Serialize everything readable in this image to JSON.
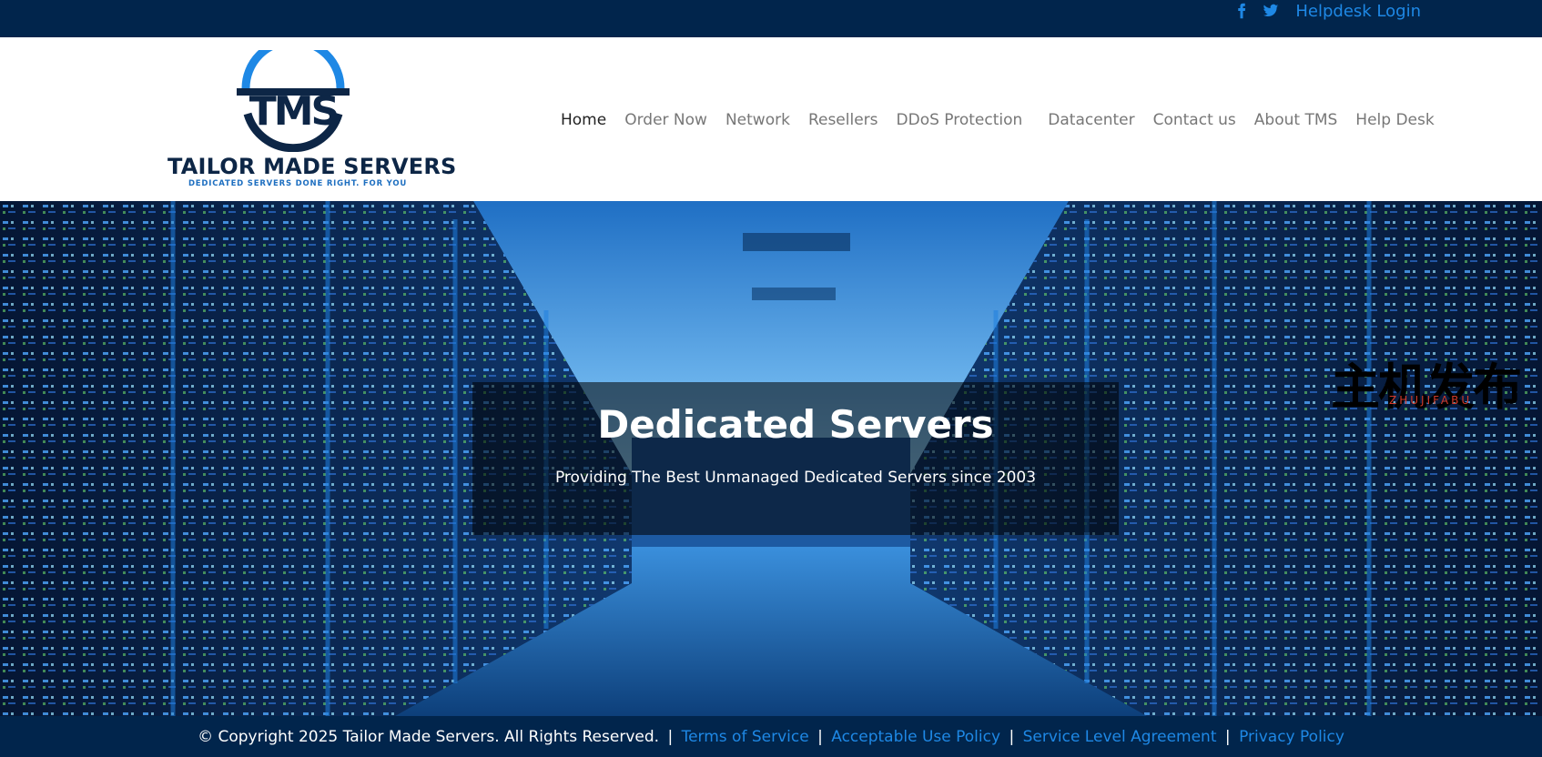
{
  "topbar": {
    "icons": [
      "facebook-icon",
      "twitter-icon"
    ],
    "helpdesk_login": "Helpdesk Login",
    "background": "#01254c",
    "link_color": "#1e88e5"
  },
  "logo": {
    "mark_text": "TMS",
    "name": "TAILOR MADE SERVERS",
    "tagline": "DEDICATED SERVERS DONE RIGHT. FOR YOU"
  },
  "nav": {
    "items": [
      {
        "label": "Home",
        "active": true
      },
      {
        "label": "Order Now"
      },
      {
        "label": "Network"
      },
      {
        "label": "Resellers"
      },
      {
        "label": "DDoS Protection"
      },
      {
        "label": "Datacenter"
      },
      {
        "label": "Contact us"
      },
      {
        "label": "About TMS"
      },
      {
        "label": "Help Desk"
      }
    ]
  },
  "hero": {
    "title": "Dedicated Servers",
    "subtitle": "Providing The Best Unmanaged Dedicated Servers since 2003"
  },
  "watermark": {
    "text": "主机发布",
    "sub": "ZHUJIFABU"
  },
  "footer": {
    "copyright": "© Copyright 2025 Tailor Made Servers. All Rights Reserved.",
    "separator": "|",
    "links": [
      "Terms of Service",
      "Acceptable Use Policy",
      "Service Level Agreement",
      "Privacy Policy"
    ]
  }
}
